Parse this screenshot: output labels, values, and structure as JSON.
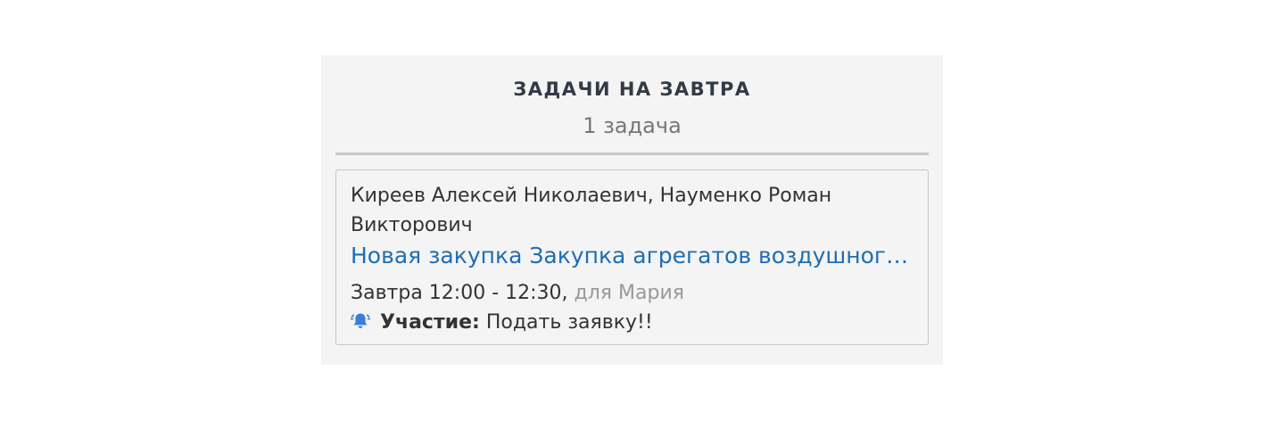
{
  "panel": {
    "title": "ЗАДАЧИ НА ЗАВТРА",
    "count_label": "1 задача"
  },
  "task": {
    "participants": "Киреев Алексей Николаевич, Науменко Роман Викторович",
    "link_text": "Новая закупка Закупка агрегатов воздушного от...",
    "time": "Завтра 12:00 - 12:30,",
    "for_label": "для Мария",
    "reminder_icon": "bell-icon",
    "type_label": "Участие:",
    "note": "Подать заявку!!"
  },
  "colors": {
    "panel_bg": "#f4f4f4",
    "link": "#1f6db3",
    "title": "#333a44",
    "muted": "#999999",
    "bell": "#3a7fd5"
  }
}
